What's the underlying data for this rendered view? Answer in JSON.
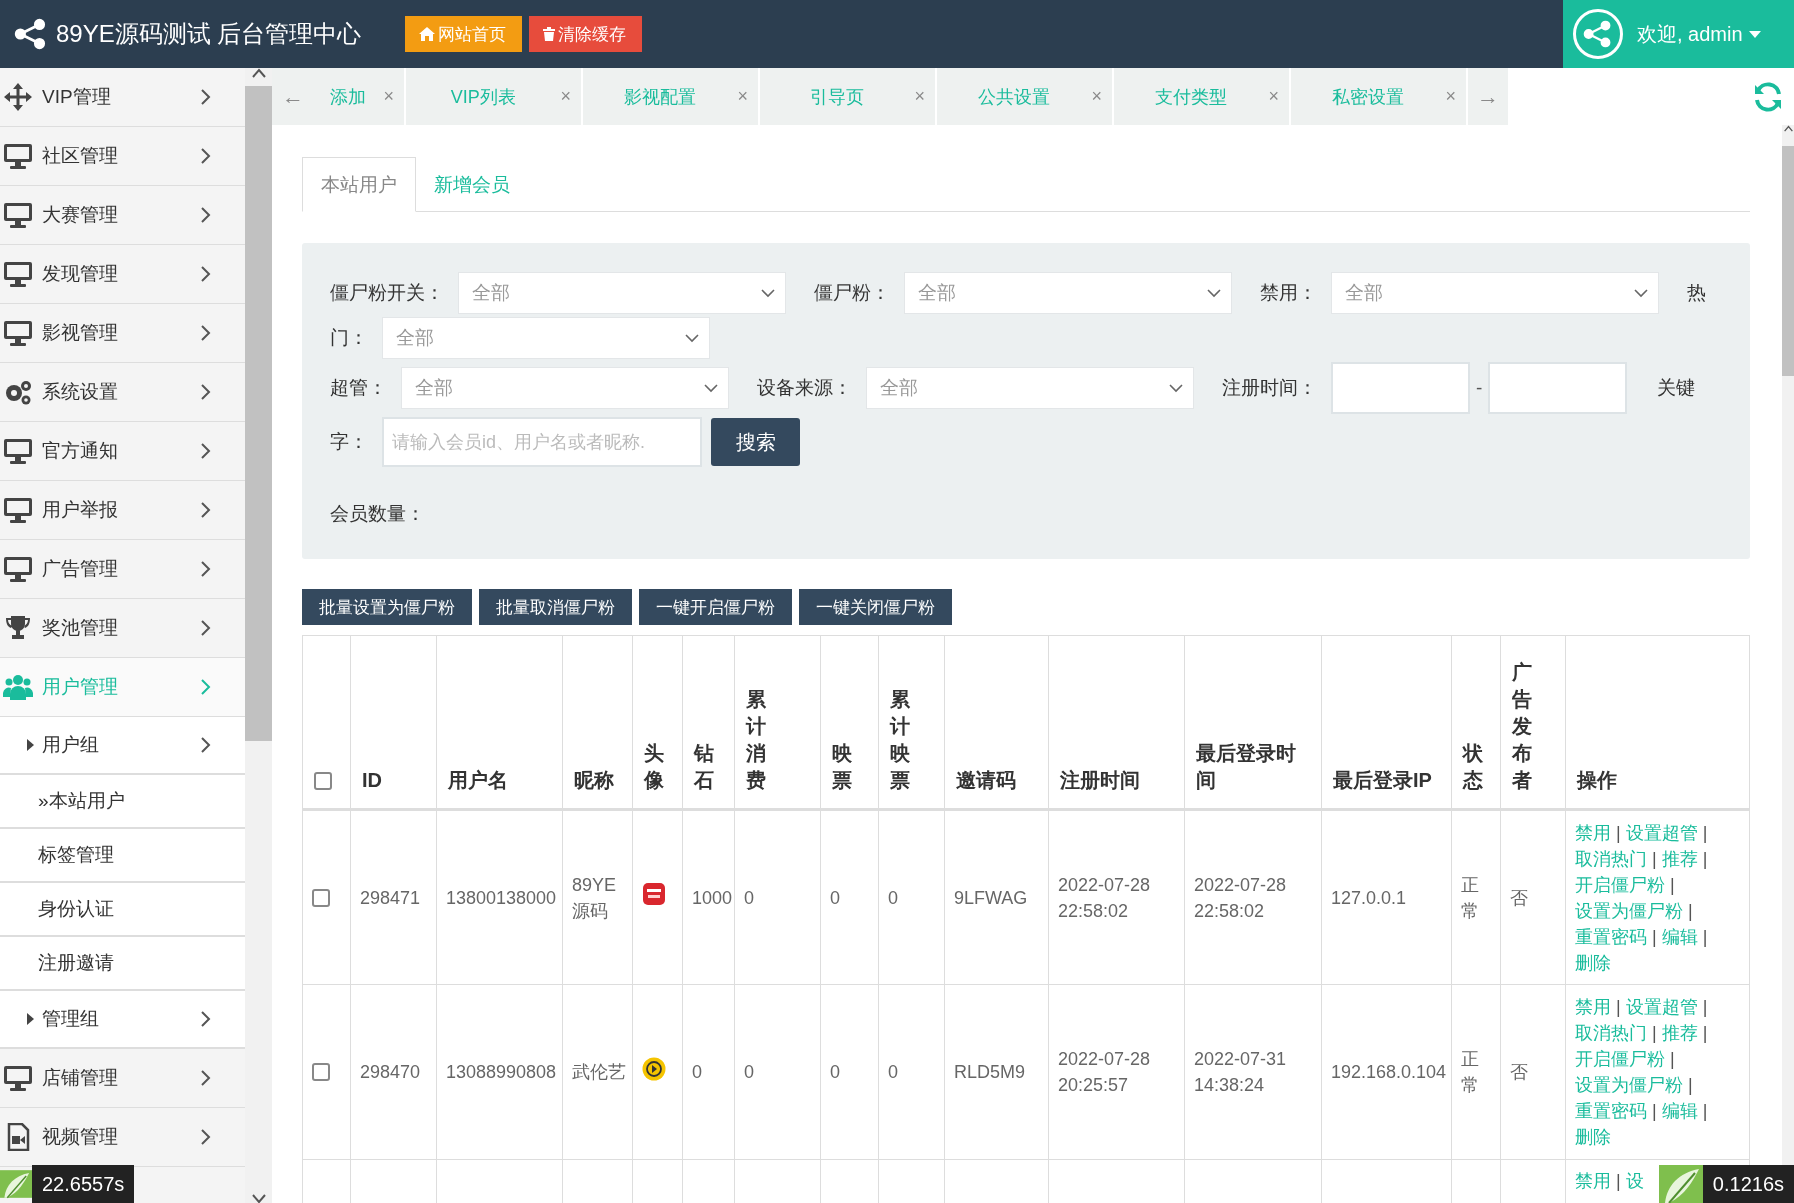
{
  "header": {
    "title": "89YE源码测试 后台管理中心",
    "buttons": [
      {
        "label": "网站首页",
        "kind": "home"
      },
      {
        "label": "清除缓存",
        "kind": "clear"
      }
    ],
    "greeting": "欢迎, admin"
  },
  "sidebar": {
    "items": [
      {
        "label": "VIP管理",
        "selected": false
      },
      {
        "label": "社区管理",
        "selected": false
      },
      {
        "label": "大赛管理",
        "selected": false
      },
      {
        "label": "发现管理",
        "selected": false
      },
      {
        "label": "影视管理",
        "selected": false
      },
      {
        "label": "系统设置",
        "selected": false
      },
      {
        "label": "官方通知",
        "selected": false
      },
      {
        "label": "用户举报",
        "selected": false
      },
      {
        "label": "广告管理",
        "selected": false
      },
      {
        "label": "奖池管理",
        "selected": false
      },
      {
        "label": "用户管理",
        "selected": true,
        "children": [
          {
            "label": "用户组",
            "children": [
              {
                "label": "»本站用户"
              },
              {
                "label": "标签管理"
              },
              {
                "label": "身份认证"
              },
              {
                "label": "注册邀请"
              }
            ]
          },
          {
            "label": "管理组"
          }
        ]
      },
      {
        "label": "店铺管理",
        "selected": false
      },
      {
        "label": "视频管理",
        "selected": false
      }
    ]
  },
  "nav_tabs": {
    "prev": "←",
    "next": "→",
    "items": [
      {
        "label": "添加",
        "close": "×"
      },
      {
        "label": "VIP列表",
        "close": "×"
      },
      {
        "label": "影视配置",
        "close": "×"
      },
      {
        "label": "引导页",
        "close": "×"
      },
      {
        "label": "公共设置",
        "close": "×"
      },
      {
        "label": "支付类型",
        "close": "×"
      },
      {
        "label": "私密设置",
        "close": "×"
      }
    ]
  },
  "page_tabs": [
    {
      "label": "本站用户",
      "selected": true
    },
    {
      "label": "新增会员",
      "selected": false
    }
  ],
  "filter_lines": [
    [
      {
        "kind": "label",
        "text": "僵尸粉开关："
      },
      {
        "kind": "select",
        "value": "全部"
      },
      {
        "kind": "label",
        "text": "僵尸粉："
      },
      {
        "kind": "select",
        "value": "全部"
      },
      {
        "kind": "label",
        "text": "禁用："
      },
      {
        "kind": "select",
        "value": "全部"
      },
      {
        "kind": "label",
        "text": "热"
      }
    ],
    [
      {
        "kind": "label",
        "text": "门："
      },
      {
        "kind": "select",
        "value": "全部"
      }
    ],
    [
      {
        "kind": "label",
        "text": "超管："
      },
      {
        "kind": "select",
        "value": "全部"
      },
      {
        "kind": "label",
        "text": "设备来源："
      },
      {
        "kind": "select",
        "value": "全部"
      },
      {
        "kind": "label",
        "text": "注册时间："
      },
      {
        "kind": "date"
      },
      {
        "kind": "separator",
        "text": "-"
      },
      {
        "kind": "date"
      },
      {
        "kind": "label",
        "text": "关键"
      }
    ],
    [
      {
        "kind": "label",
        "text": "字："
      },
      {
        "kind": "text",
        "placeholder": "请输入会员id、用户名或者昵称."
      },
      {
        "kind": "button",
        "text": "搜索"
      }
    ]
  ],
  "member_count_label": "会员数量：",
  "bulk_actions": [
    "批量设置为僵尸粉",
    "批量取消僵尸粉",
    "一键开启僵尸粉",
    "一键关闭僵尸粉"
  ],
  "table": {
    "select_all": false,
    "action_separator": "|",
    "columns": [
      "ID",
      "用户名",
      "昵称",
      "头像",
      "钻石",
      "累计消费",
      "映票",
      "累计映票",
      "邀请码",
      "注册时间",
      "最后登录时间",
      "最后登录IP",
      "状态",
      "广告发布者",
      "操作"
    ],
    "rows": [
      {
        "checked": false,
        "cells": [
          "298471",
          "13800138000",
          "89YE源码",
          null,
          "1000",
          "0",
          "0",
          "0",
          "9LFWAG",
          "2022-07-28 22:58:02",
          "2022-07-28 22:58:02",
          "127.0.0.1",
          "正常",
          "否"
        ],
        "actions": [
          "禁用",
          "设置超管",
          "取消热门",
          "推荐",
          "开启僵尸粉",
          "设置为僵尸粉",
          "重置密码",
          "编辑",
          "删除"
        ]
      },
      {
        "checked": false,
        "cells": [
          "298470",
          "13088990808",
          "武伦艺",
          null,
          "0",
          "0",
          "0",
          "0",
          "RLD5M9",
          "2022-07-28 20:25:57",
          "2022-07-31 14:38:24",
          "192.168.0.104",
          "正常",
          "否"
        ],
        "actions": [
          "禁用",
          "设置超管",
          "取消热门",
          "推荐",
          "开启僵尸粉",
          "设置为僵尸粉",
          "重置密码",
          "编辑",
          "删除"
        ]
      },
      {
        "actions": [
          "禁用",
          "设"
        ]
      }
    ]
  },
  "timers": [
    "22.6557s",
    "0.1216s"
  ]
}
